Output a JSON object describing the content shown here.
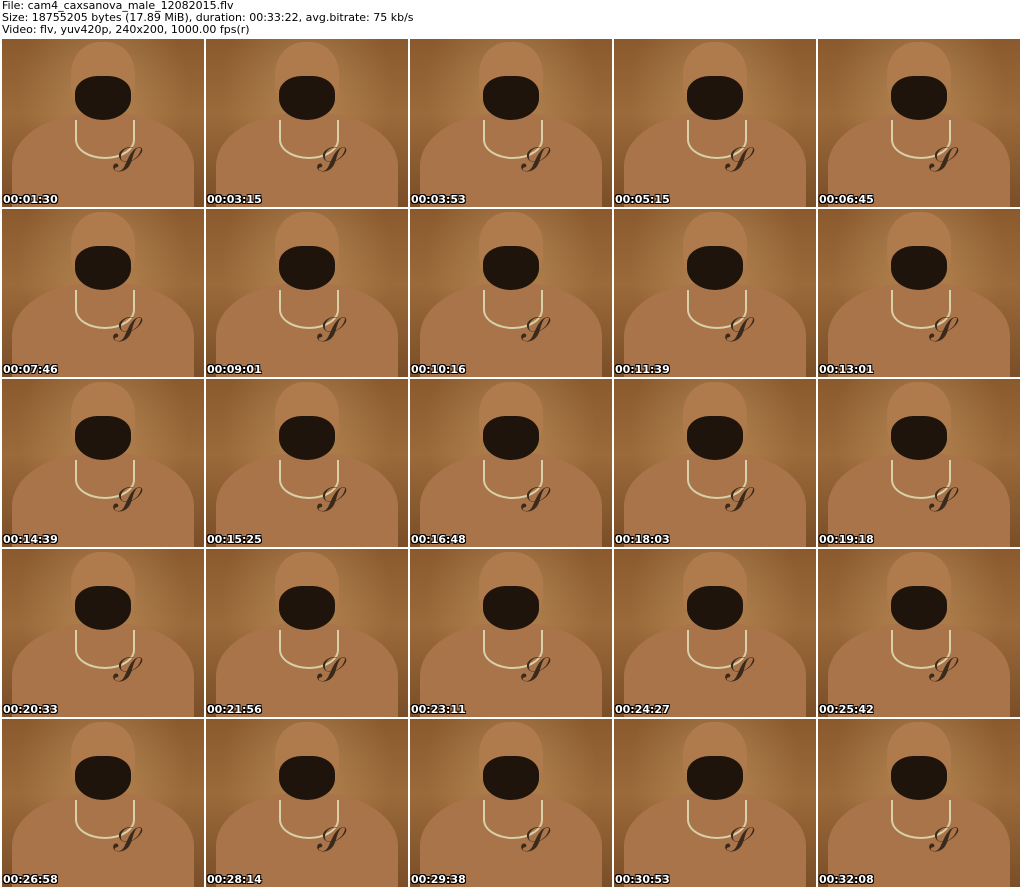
{
  "header": {
    "file_line": "File: cam4_caxsanova_male_12082015.flv",
    "size_line": "Size: 18755205 bytes (17.89 MiB), duration: 00:33:22, avg.bitrate: 75 kb/s",
    "video_line": "Video: flv, yuv420p, 240x200, 1000.00 fps(r)"
  },
  "thumbnails": [
    {
      "timestamp": "00:01:30"
    },
    {
      "timestamp": "00:03:15"
    },
    {
      "timestamp": "00:03:53"
    },
    {
      "timestamp": "00:05:15"
    },
    {
      "timestamp": "00:06:45"
    },
    {
      "timestamp": "00:07:46"
    },
    {
      "timestamp": "00:09:01"
    },
    {
      "timestamp": "00:10:16"
    },
    {
      "timestamp": "00:11:39"
    },
    {
      "timestamp": "00:13:01"
    },
    {
      "timestamp": "00:14:39"
    },
    {
      "timestamp": "00:15:25"
    },
    {
      "timestamp": "00:16:48"
    },
    {
      "timestamp": "00:18:03"
    },
    {
      "timestamp": "00:19:18"
    },
    {
      "timestamp": "00:20:33"
    },
    {
      "timestamp": "00:21:56"
    },
    {
      "timestamp": "00:23:11"
    },
    {
      "timestamp": "00:24:27"
    },
    {
      "timestamp": "00:25:42"
    },
    {
      "timestamp": "00:26:58"
    },
    {
      "timestamp": "00:28:14"
    },
    {
      "timestamp": "00:29:38"
    },
    {
      "timestamp": "00:30:53"
    },
    {
      "timestamp": "00:32:08"
    }
  ]
}
